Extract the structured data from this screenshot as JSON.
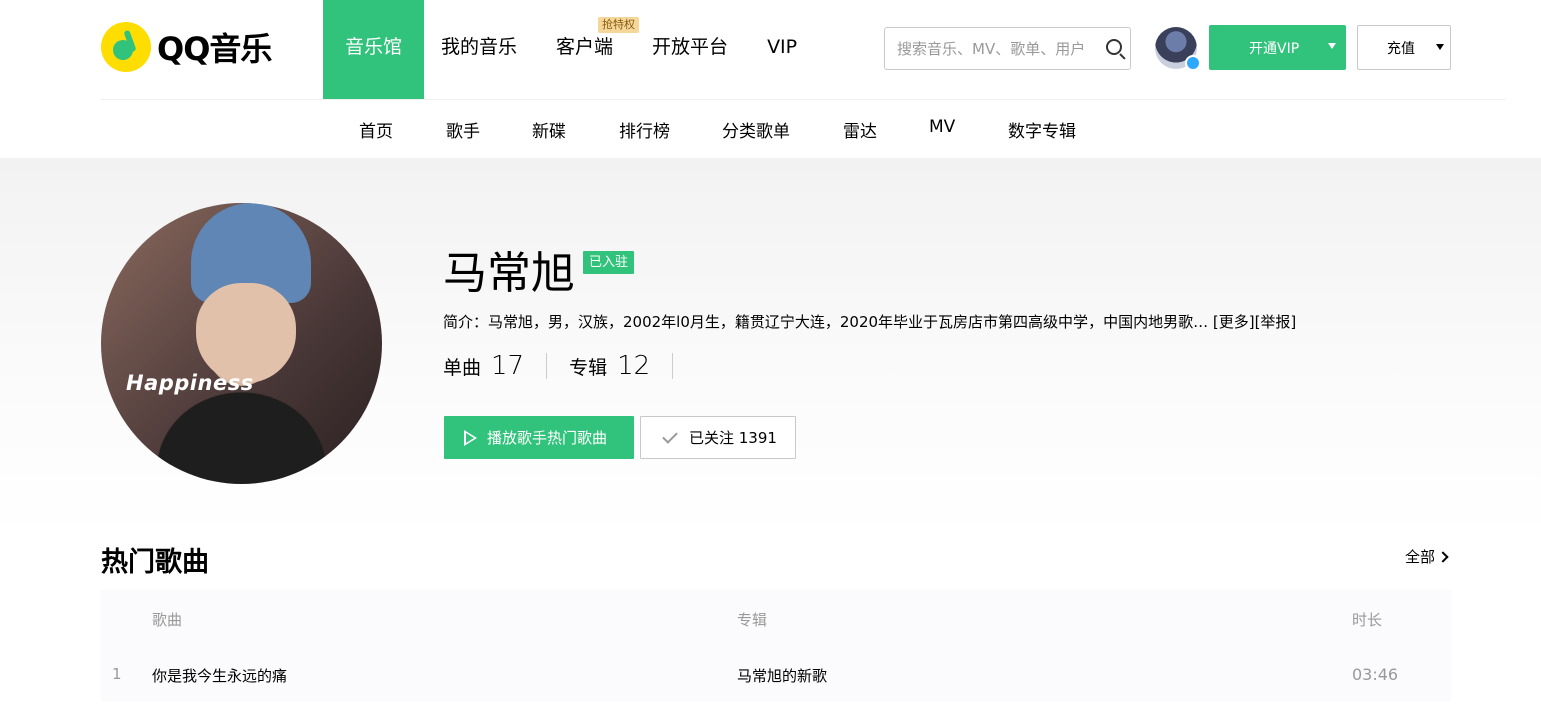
{
  "logo": {
    "text": "QQ音乐"
  },
  "main_nav": [
    {
      "label": "音乐馆",
      "active": true
    },
    {
      "label": "我的音乐"
    },
    {
      "label": "客户端",
      "badge": "抢特权"
    },
    {
      "label": "开放平台"
    },
    {
      "label": "VIP"
    }
  ],
  "search": {
    "placeholder": "搜索音乐、MV、歌单、用户"
  },
  "account": {
    "vip_button": "开通VIP",
    "recharge_button": "充值"
  },
  "sub_nav": [
    "首页",
    "歌手",
    "新碟",
    "排行榜",
    "分类歌单",
    "雷达",
    "MV",
    "数字专辑"
  ],
  "artist": {
    "name": "马常旭",
    "status_tag": "已入驻",
    "photo_caption": "Happiness",
    "intro": "简介：马常旭，男，汉族，2002年l0月生，籍贯辽宁大连，2020年毕业于瓦房店市第四高级中学，中国内地男歌…",
    "more_link": "[更多]",
    "report_link": "[举报]",
    "stats": {
      "singles_label": "单曲",
      "singles_value": "17",
      "albums_label": "专辑",
      "albums_value": "12"
    },
    "play_button": "播放歌手热门歌曲",
    "follow_button": "已关注 1391"
  },
  "hot_songs": {
    "title": "热门歌曲",
    "see_all": "全部",
    "columns": {
      "song": "歌曲",
      "album": "专辑",
      "duration": "时长"
    },
    "rows": [
      {
        "index": "1",
        "name": "你是我今生永远的痛",
        "album": "马常旭的新歌",
        "duration": "03:46"
      }
    ]
  },
  "colors": {
    "brand_green": "#31c27c",
    "logo_yellow": "#ffdd00",
    "badge_gold": "#f5d799"
  }
}
